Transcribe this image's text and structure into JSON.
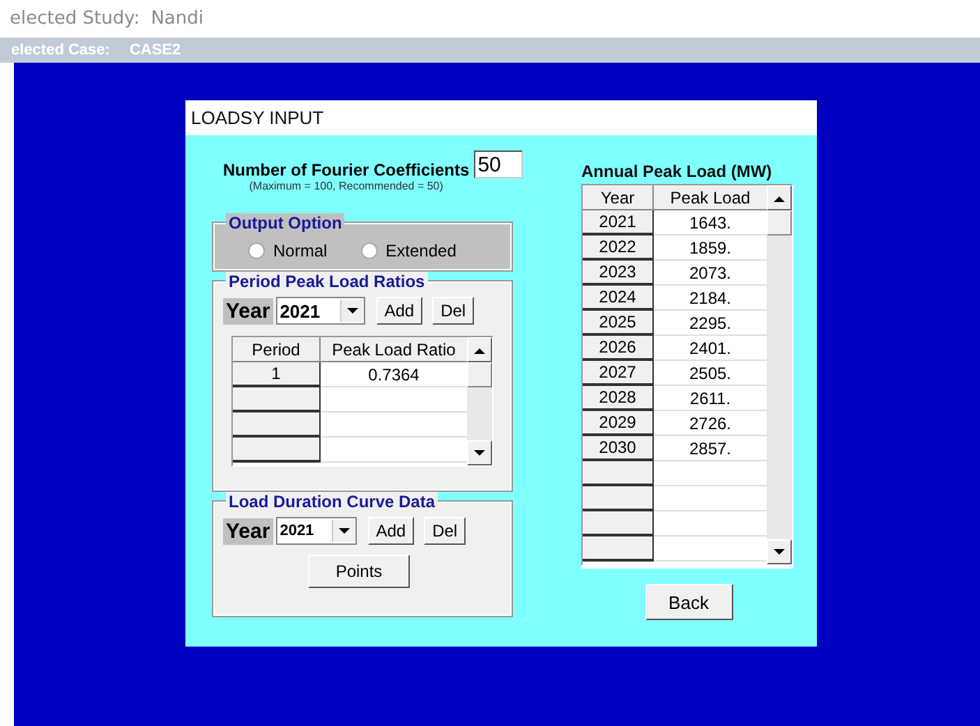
{
  "header": {
    "study_label": "elected Study:",
    "study_value": "Nandi",
    "case_label": "elected Case:",
    "case_value": "CASE2"
  },
  "dialog": {
    "title": "LOADSY INPUT",
    "fourier": {
      "label": "Number of Fourier Coefficients",
      "note": "(Maximum = 100, Recommended = 50)",
      "value": "50"
    },
    "output_option": {
      "title": "Output Option",
      "options": [
        {
          "label": "Normal",
          "selected": false
        },
        {
          "label": "Extended",
          "selected": false
        }
      ]
    },
    "period_ratios": {
      "title": "Period Peak Load Ratios",
      "year_label": "Year",
      "year_value": "2021",
      "buttons": [
        "Add",
        "Del"
      ],
      "table": {
        "columns": [
          "Period",
          "Peak Load Ratio"
        ],
        "rows": [
          [
            "1",
            "0.7364"
          ]
        ]
      }
    },
    "load_duration": {
      "title": "Load Duration Curve Data",
      "year_label": "Year",
      "year_value": "2021",
      "buttons": [
        "Add",
        "Del"
      ],
      "points_button": "Points"
    },
    "annual_peak": {
      "title": "Annual Peak Load (MW)",
      "columns": [
        "Year",
        "Peak Load"
      ],
      "rows": [
        [
          "2021",
          "1643."
        ],
        [
          "2022",
          "1859."
        ],
        [
          "2023",
          "2073."
        ],
        [
          "2024",
          "2184."
        ],
        [
          "2025",
          "2295."
        ],
        [
          "2026",
          "2401."
        ],
        [
          "2027",
          "2505."
        ],
        [
          "2028",
          "2611."
        ],
        [
          "2029",
          "2726."
        ],
        [
          "2030",
          "2857."
        ]
      ]
    },
    "back_button": "Back"
  }
}
